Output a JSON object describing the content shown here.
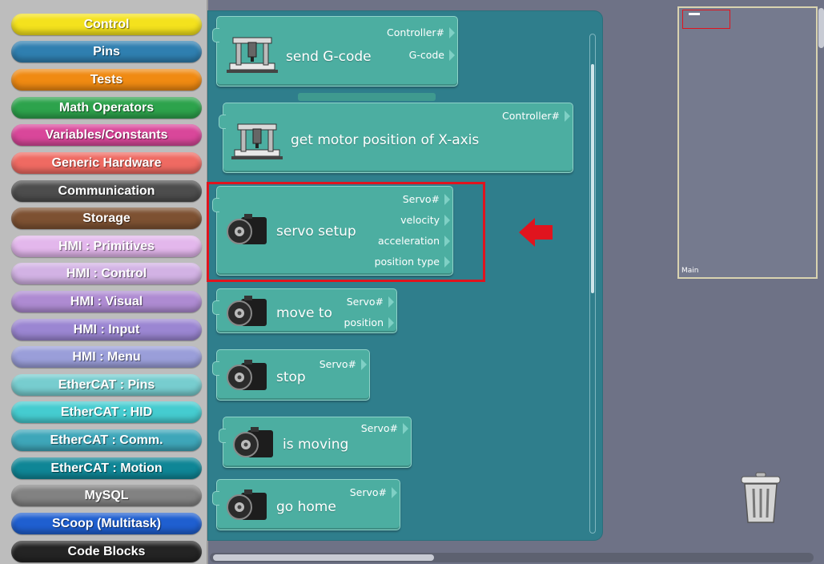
{
  "categories": [
    {
      "label": "Control",
      "color": "#f4e21d",
      "text_color": "#ffffff"
    },
    {
      "label": "Pins",
      "color": "#2f7fb0"
    },
    {
      "label": "Tests",
      "color": "#f08a12"
    },
    {
      "label": "Math Operators",
      "color": "#2da34c"
    },
    {
      "label": "Variables/Constants",
      "color": "#d9479a"
    },
    {
      "label": "Generic Hardware",
      "color": "#ef6a62"
    },
    {
      "label": "Communication",
      "color": "#4d4d4d"
    },
    {
      "label": "Storage",
      "color": "#7d5132"
    },
    {
      "label": "HMI : Primitives",
      "color": "#e3b7ec"
    },
    {
      "label": "HMI : Control",
      "color": "#d2b2e4"
    },
    {
      "label": "HMI : Visual",
      "color": "#ae8bd2"
    },
    {
      "label": "HMI : Input",
      "color": "#9b86d2"
    },
    {
      "label": "HMI : Menu",
      "color": "#9a9ed9"
    },
    {
      "label": "EtherCAT : Pins",
      "color": "#77cdcf"
    },
    {
      "label": "EtherCAT : HID",
      "color": "#45ccd0"
    },
    {
      "label": "EtherCAT : Comm.",
      "color": "#3ea6b9"
    },
    {
      "label": "EtherCAT : Motion",
      "color": "#0f8696"
    },
    {
      "label": "MySQL",
      "color": "#828282"
    },
    {
      "label": "SCoop (Multitask)",
      "color": "#1f5fd0"
    },
    {
      "label": "Code Blocks",
      "color": "#242424"
    }
  ],
  "blocks": {
    "send_gcode": {
      "title": "send G-code",
      "params": [
        "Controller#",
        "G-code"
      ]
    },
    "get_motor_position": {
      "title": "get motor position of X-axis",
      "params": [
        "Controller#"
      ]
    },
    "servo_setup": {
      "title": "servo setup",
      "params": [
        "Servo#",
        "velocity",
        "acceleration",
        "position type"
      ]
    },
    "move_to": {
      "title": "move to",
      "params": [
        "Servo#",
        "position"
      ]
    },
    "stop": {
      "title": "stop",
      "params": [
        "Servo#"
      ]
    },
    "is_moving": {
      "title": "is moving",
      "params": [
        "Servo#"
      ]
    },
    "go_home": {
      "title": "go home",
      "params": [
        "Servo#"
      ]
    }
  },
  "minimap": {
    "label": "Main"
  },
  "colors": {
    "highlight": "#e0141e",
    "flyout": "#2f7e8c",
    "block": "#4caea1",
    "workspace": "#6e7286"
  },
  "icons": {
    "cnc": "cnc-machine-icon",
    "servo": "servo-motor-icon",
    "trash": "trash-can-icon",
    "arrow": "red-arrow-left-icon"
  }
}
